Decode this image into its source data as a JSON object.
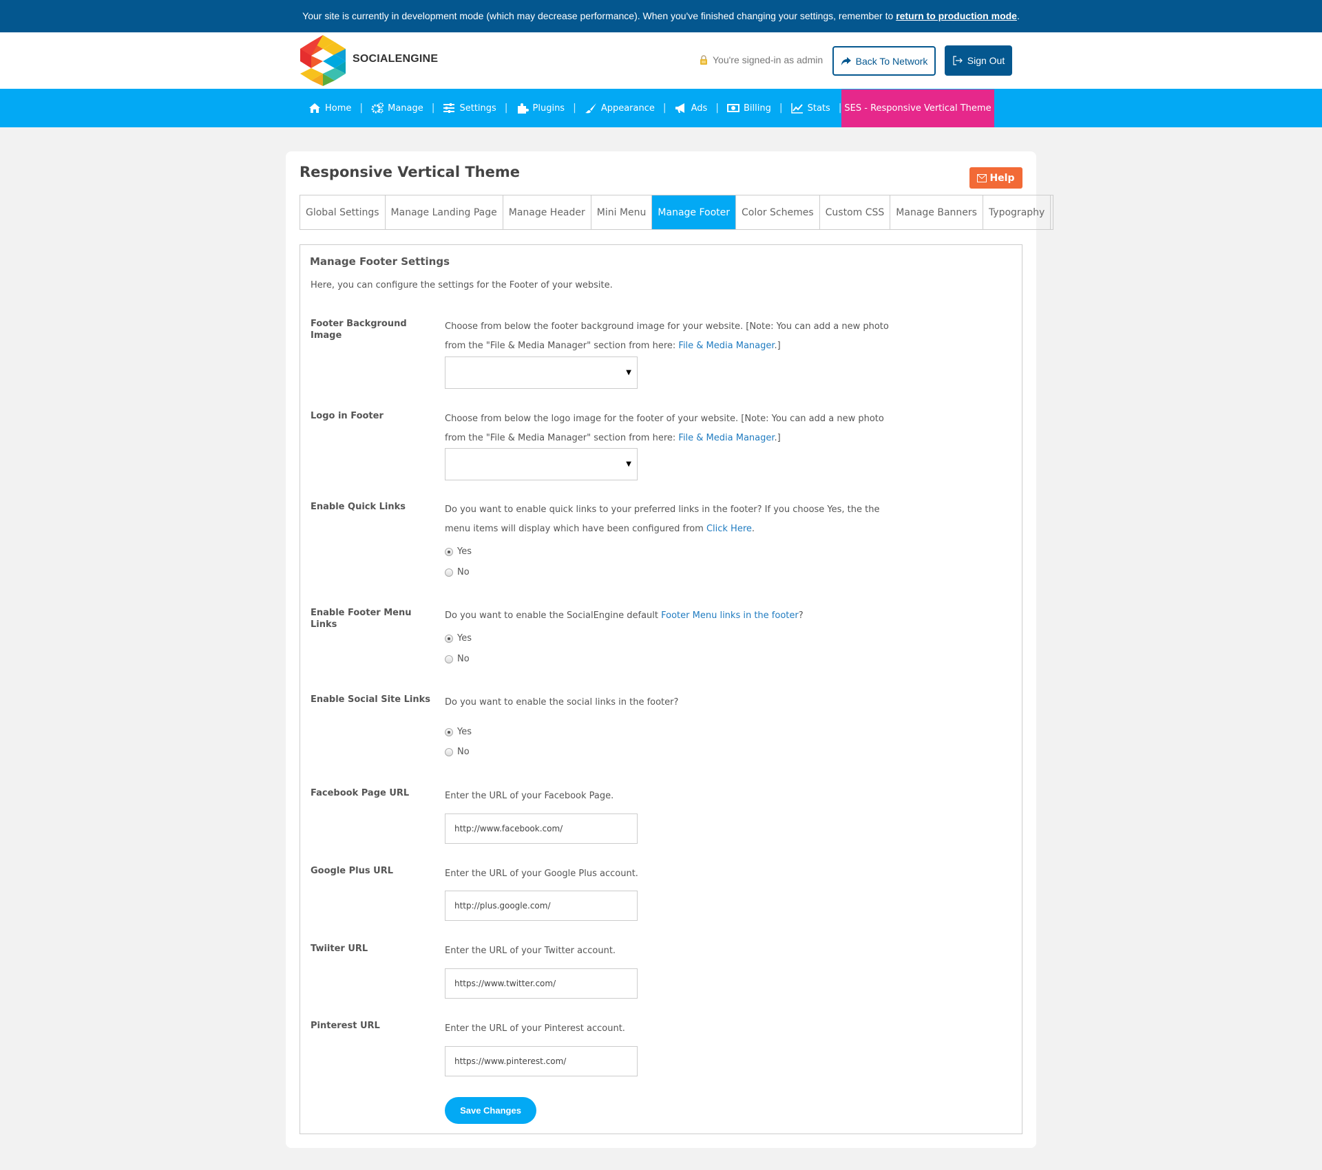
{
  "devbar": {
    "message": "Your site is currently in development mode (which may decrease performance). When you've finished changing your settings, remember to ",
    "link": "return to production mode",
    "end": "."
  },
  "header": {
    "brand": "SOCIALENGINE",
    "signed_in": "You're signed-in as admin",
    "back_label": "Back To Network",
    "signout_label": "Sign Out"
  },
  "nav": {
    "items": [
      {
        "label": "Home",
        "icon": "home-icon"
      },
      {
        "label": "Manage",
        "icon": "gears-icon"
      },
      {
        "label": "Settings",
        "icon": "sliders-icon"
      },
      {
        "label": "Plugins",
        "icon": "puzzle-icon"
      },
      {
        "label": "Appearance",
        "icon": "brush-icon"
      },
      {
        "label": "Ads",
        "icon": "megaphone-icon"
      },
      {
        "label": "Billing",
        "icon": "money-icon"
      },
      {
        "label": "Stats",
        "icon": "chart-icon"
      }
    ],
    "active": "SES - Responsive Vertical Theme"
  },
  "page": {
    "title": "Responsive Vertical Theme",
    "help": "Help",
    "tabs": [
      "Global Settings",
      "Manage Landing Page",
      "Manage Header",
      "Mini Menu",
      "Manage Footer",
      "Color Schemes",
      "Custom CSS",
      "Manage Banners",
      "Typography"
    ],
    "active_tab": "Manage Footer"
  },
  "form": {
    "title": "Manage Footer Settings",
    "intro": "Here, you can configure the settings for the Footer of your website.",
    "bg_image": {
      "label": "Footer Background Image",
      "desc": "Choose from below the footer background image for your website. [Note: You can add a new photo from the \"File & Media Manager\" section from here: ",
      "link": "File & Media Manager",
      "end": ".]",
      "value": ""
    },
    "logo": {
      "label": "Logo in Footer",
      "desc": "Choose from below the logo image for the footer of your website. [Note: You can add a new photo from the \"File & Media Manager\" section from here: ",
      "link": "File & Media Manager",
      "end": ".]",
      "value": ""
    },
    "quick_links": {
      "label": "Enable Quick Links",
      "desc": "Do you want to enable quick links to your preferred links in the footer? If you choose Yes, the the menu items will display which have been configured from ",
      "link": "Click Here",
      "end": ".",
      "options": [
        "Yes",
        "No"
      ],
      "selected": "Yes"
    },
    "footer_menu": {
      "label": "Enable Footer Menu Links",
      "desc": "Do you want to enable the SocialEngine default ",
      "link": "Footer Menu links in the footer",
      "end": "?",
      "options": [
        "Yes",
        "No"
      ],
      "selected": "Yes"
    },
    "social": {
      "label": "Enable Social Site Links",
      "desc": "Do you want to enable the social links in the footer?",
      "options": [
        "Yes",
        "No"
      ],
      "selected": "Yes"
    },
    "facebook": {
      "label": "Facebook Page URL",
      "desc": "Enter the URL of your Facebook Page.",
      "value": "http://www.facebook.com/"
    },
    "google": {
      "label": "Google Plus URL",
      "desc": "Enter the URL of your Google Plus account.",
      "value": "http://plus.google.com/"
    },
    "twitter": {
      "label": "Twiiter URL",
      "desc": "Enter the URL of your Twitter account.",
      "value": "https://www.twitter.com/"
    },
    "pinterest": {
      "label": "Pinterest URL",
      "desc": "Enter the URL of your Pinterest account.",
      "value": "https://www.pinterest.com/"
    },
    "save_label": "Save Changes"
  },
  "colors": {
    "devbar": "#04578f",
    "nav": "#03a9f4",
    "nav_active": "#e6288b",
    "help": "#f26a36",
    "link": "#1f7bc0"
  }
}
